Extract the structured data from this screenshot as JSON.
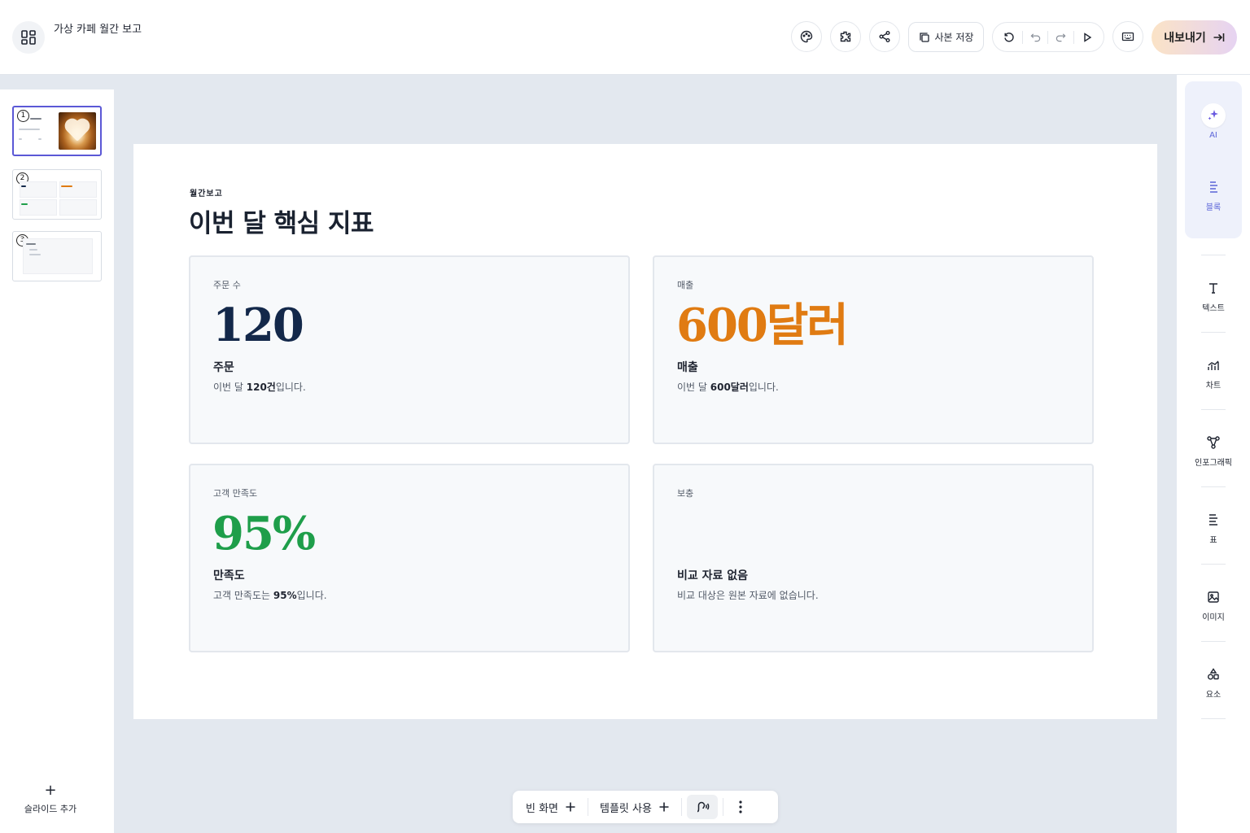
{
  "header": {
    "doc_title": "가상 카페 월간 보고",
    "save_copy_label": "사본 저장",
    "export_label": "내보내기"
  },
  "slides_panel": {
    "thumbnails": [
      {
        "number": "1"
      },
      {
        "number": "2"
      },
      {
        "number": "3"
      }
    ],
    "add_slide_label": "슬라이드 추가"
  },
  "slide": {
    "eyebrow": "월간보고",
    "title": "이번 달 핵심 지표",
    "cards": [
      {
        "label": "주문 수",
        "value": "120",
        "heading": "주문",
        "desc_prefix": "이번 달 ",
        "desc_bold": "120건",
        "desc_suffix": "입니다.",
        "value_color": "#13284a"
      },
      {
        "label": "매출",
        "value": "600달러",
        "heading": "매출",
        "desc_prefix": "이번 달 ",
        "desc_bold": "600달러",
        "desc_suffix": "입니다.",
        "value_color": "#e07b12"
      },
      {
        "label": "고객 만족도",
        "value": "95%",
        "heading": "만족도",
        "desc_prefix": "고객 만족도는 ",
        "desc_bold": "95%",
        "desc_suffix": "입니다.",
        "value_color": "#1e9e4a"
      },
      {
        "label": "보충",
        "value": "",
        "heading": "비교 자료 없음",
        "desc_prefix": "비교 대상은 원본 자료에 없습니다.",
        "desc_bold": "",
        "desc_suffix": "",
        "value_color": "#13284a"
      }
    ]
  },
  "tools": {
    "ai": "AI",
    "block": "블록",
    "text": "텍스트",
    "chart": "차트",
    "infographic": "인포그래픽",
    "table": "표",
    "image": "이미지",
    "element": "요소"
  },
  "bottom_bar": {
    "blank_label": "빈 화면",
    "template_label": "템플릿 사용"
  },
  "colors": {
    "accent": "#5b58d6",
    "orders": "#13284a",
    "revenue": "#e07b12",
    "satisfaction": "#1e9e4a"
  }
}
